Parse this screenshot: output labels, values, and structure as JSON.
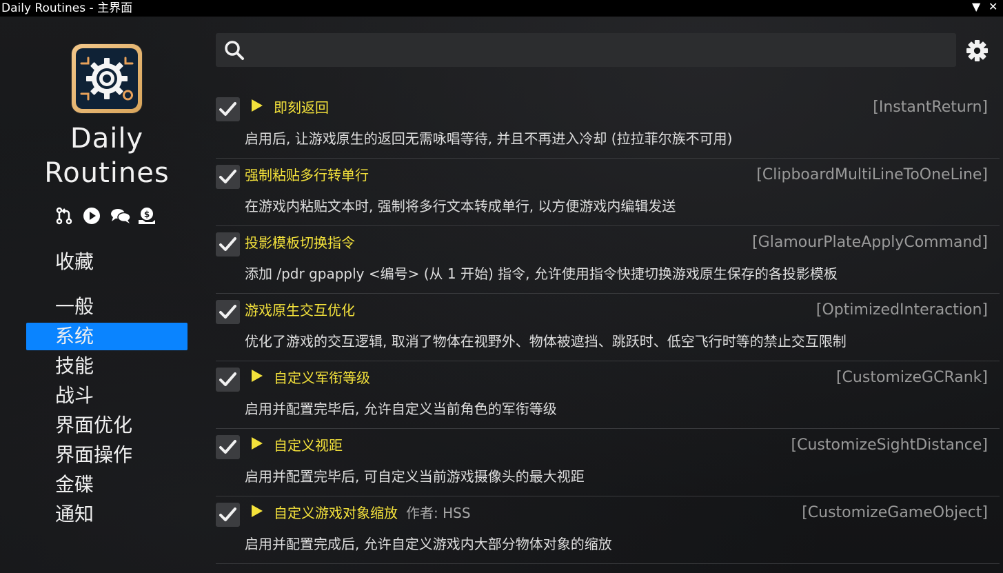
{
  "window": {
    "title": "Daily Routines - 主界面",
    "menu_glyph": "▼",
    "close_glyph": "✕"
  },
  "sidebar": {
    "app_name_line1": "Daily",
    "app_name_line2": "Routines",
    "icons": [
      "git-pull-request-icon",
      "play-circle-icon",
      "chat-bubbles-icon",
      "donate-icon"
    ],
    "items": [
      {
        "label": "收藏",
        "active": false
      },
      {
        "label": "一般",
        "active": false
      },
      {
        "label": "系统",
        "active": true
      },
      {
        "label": "技能",
        "active": false
      },
      {
        "label": "战斗",
        "active": false
      },
      {
        "label": "界面优化",
        "active": false
      },
      {
        "label": "界面操作",
        "active": false
      },
      {
        "label": "金碟",
        "active": false
      },
      {
        "label": "通知",
        "active": false
      }
    ]
  },
  "search": {
    "value": "",
    "placeholder": ""
  },
  "accent_color": "#0a84ff",
  "title_color": "#f4e23b",
  "modules": [
    {
      "title": "即刻返回",
      "id": "[InstantReturn]",
      "description": "启用后, 让游戏原生的返回无需咏唱等待, 并且不再进入冷却 (拉拉菲尔族不可用)",
      "has_arrow": true,
      "author": "",
      "enabled": true
    },
    {
      "title": "强制粘贴多行转单行",
      "id": "[ClipboardMultiLineToOneLine]",
      "description": "在游戏内粘贴文本时, 强制将多行文本转成单行, 以方便游戏内编辑发送",
      "has_arrow": false,
      "author": "",
      "enabled": true
    },
    {
      "title": "投影模板切换指令",
      "id": "[GlamourPlateApplyCommand]",
      "description": "添加 /pdr gpapply <编号> (从 1 开始) 指令, 允许使用指令快捷切换游戏原生保存的各投影模板",
      "has_arrow": false,
      "author": "",
      "enabled": true
    },
    {
      "title": "游戏原生交互优化",
      "id": "[OptimizedInteraction]",
      "description": "优化了游戏的交互逻辑, 取消了物体在视野外、物体被遮挡、跳跃时、低空飞行时等的禁止交互限制",
      "has_arrow": false,
      "author": "",
      "enabled": true
    },
    {
      "title": "自定义军衔等级",
      "id": "[CustomizeGCRank]",
      "description": "启用并配置完毕后, 允许自定义当前角色的军衔等级",
      "has_arrow": true,
      "author": "",
      "enabled": true
    },
    {
      "title": "自定义视距",
      "id": "[CustomizeSightDistance]",
      "description": "启用并配置完毕后, 可自定义当前游戏摄像头的最大视距",
      "has_arrow": true,
      "author": "",
      "enabled": true
    },
    {
      "title": "自定义游戏对象缩放",
      "id": "[CustomizeGameObject]",
      "description": "启用并配置完成后, 允许自定义游戏内大部分物体对象的缩放",
      "has_arrow": true,
      "author": "作者: HSS",
      "enabled": true
    }
  ]
}
